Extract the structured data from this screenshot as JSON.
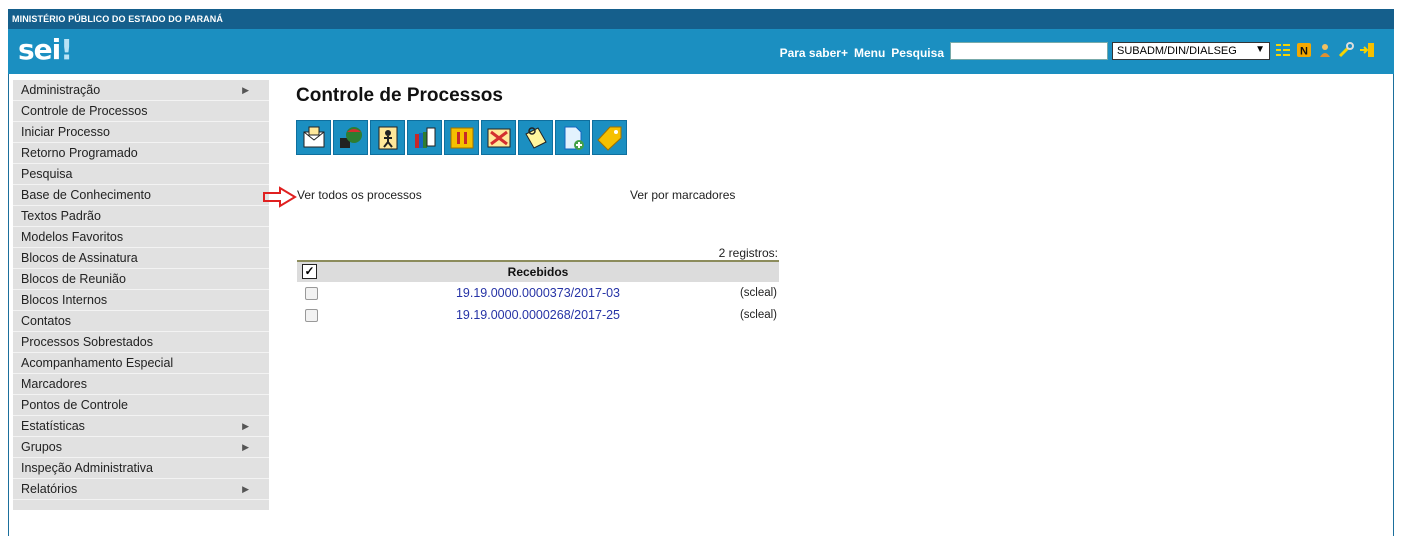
{
  "org": {
    "name": "MINISTÉRIO PÚBLICO DO ESTADO DO PARANÁ"
  },
  "header": {
    "logo": "sei",
    "links": {
      "learn": "Para saber+",
      "menu": "Menu",
      "search": "Pesquisa"
    },
    "search_value": "",
    "unit": "SUBADM/DIN/DIALSEG"
  },
  "header_icons": [
    "list-icon",
    "notes-icon",
    "user-icon",
    "tools-icon",
    "exit-icon"
  ],
  "sidebar": {
    "items": [
      {
        "label": "Administração",
        "submenu": true
      },
      {
        "label": "Controle de Processos",
        "submenu": false
      },
      {
        "label": "Iniciar Processo",
        "submenu": false
      },
      {
        "label": "Retorno Programado",
        "submenu": false
      },
      {
        "label": "Pesquisa",
        "submenu": false
      },
      {
        "label": "Base de Conhecimento",
        "submenu": false
      },
      {
        "label": "Textos Padrão",
        "submenu": false
      },
      {
        "label": "Modelos Favoritos",
        "submenu": false
      },
      {
        "label": "Blocos de Assinatura",
        "submenu": false
      },
      {
        "label": "Blocos de Reunião",
        "submenu": false
      },
      {
        "label": "Blocos Internos",
        "submenu": false
      },
      {
        "label": "Contatos",
        "submenu": false
      },
      {
        "label": "Processos Sobrestados",
        "submenu": false
      },
      {
        "label": "Acompanhamento Especial",
        "submenu": false
      },
      {
        "label": "Marcadores",
        "submenu": false
      },
      {
        "label": "Pontos de Controle",
        "submenu": false
      },
      {
        "label": "Estatísticas",
        "submenu": true
      },
      {
        "label": "Grupos",
        "submenu": true
      },
      {
        "label": "Inspeção Administrativa",
        "submenu": false
      },
      {
        "label": "Relatórios",
        "submenu": true
      }
    ]
  },
  "main": {
    "title": "Controle de Processos",
    "toolbar_icons": [
      "send-process-icon",
      "update-progress-icon",
      "assign-process-icon",
      "signature-block-icon",
      "suspend-process-icon",
      "remove-mark-icon",
      "annotation-icon",
      "new-document-icon",
      "tag-icon"
    ],
    "view_all": "Ver todos os processos",
    "view_markers": "Ver por marcadores",
    "records": "2 registros:",
    "table": {
      "header": "Recebidos",
      "rows": [
        {
          "process": "19.19.0000.0000373/2017-03",
          "user": "(scleal)"
        },
        {
          "process": "19.19.0000.0000268/2017-25",
          "user": "(scleal)"
        }
      ]
    }
  },
  "colors": {
    "header": "#1b8fc1",
    "org_bar": "#155f8c",
    "sidebar": "#e1e1e1",
    "link": "#2633a6",
    "annotation_arrow": "#e02020"
  }
}
